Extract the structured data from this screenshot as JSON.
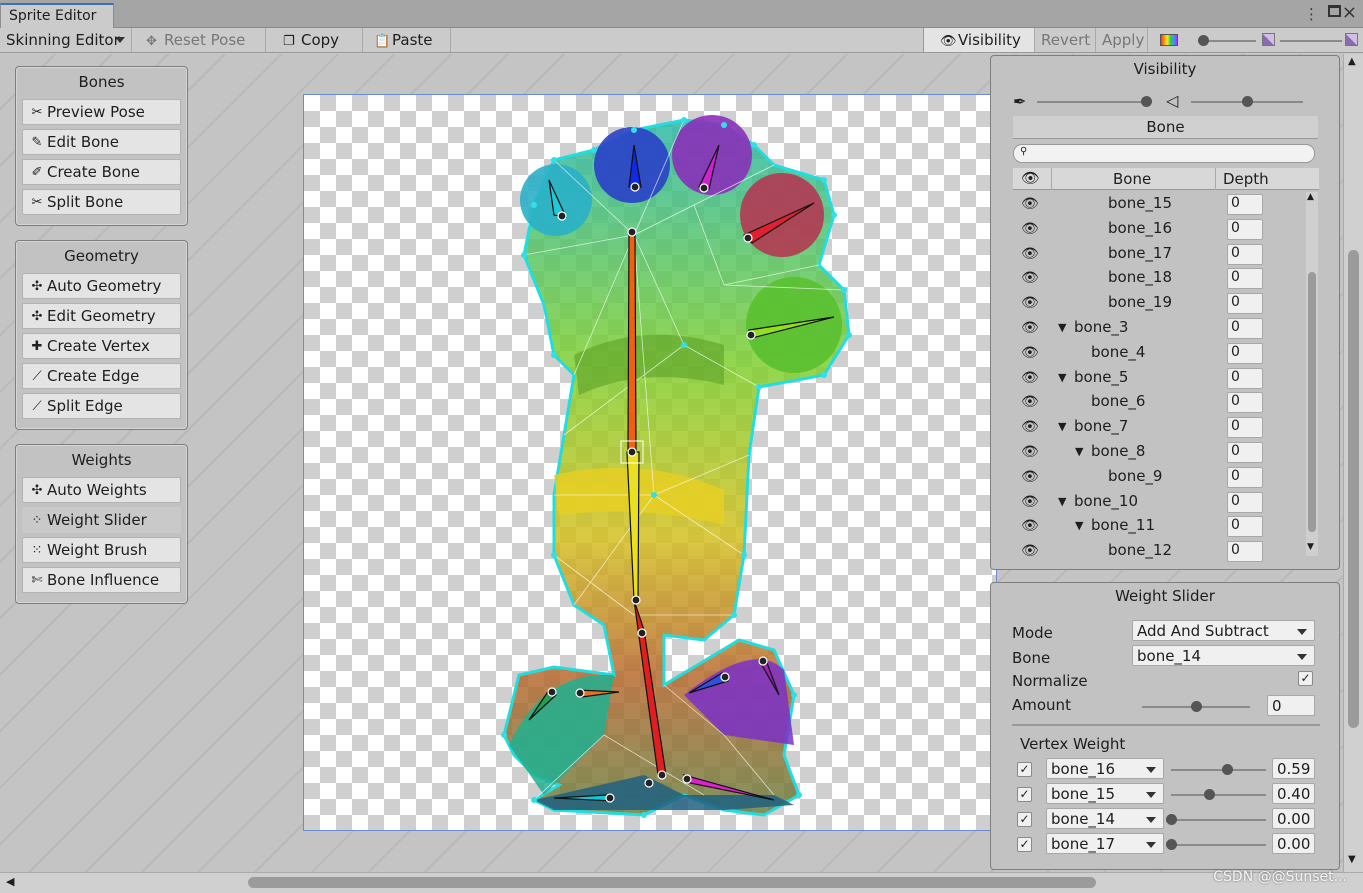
{
  "window": {
    "tab_title": "Sprite Editor"
  },
  "toolbar": {
    "mode_dropdown": "Skinning Editor",
    "reset_pose": "Reset Pose",
    "copy": "Copy",
    "paste": "Paste",
    "visibility": "Visibility",
    "revert": "Revert",
    "apply": "Apply"
  },
  "panels": {
    "bones": {
      "title": "Bones",
      "items": [
        "Preview Pose",
        "Edit Bone",
        "Create Bone",
        "Split Bone"
      ]
    },
    "geometry": {
      "title": "Geometry",
      "items": [
        "Auto Geometry",
        "Edit Geometry",
        "Create Vertex",
        "Create Edge",
        "Split Edge"
      ]
    },
    "weights": {
      "title": "Weights",
      "items": [
        "Auto Weights",
        "Weight Slider",
        "Weight Brush",
        "Bone Influence"
      ],
      "selected": "Weight Slider"
    }
  },
  "visibility_panel": {
    "title": "Visibility",
    "tab": "Bone",
    "search_placeholder": "",
    "columns": {
      "name": "Bone",
      "depth": "Depth"
    },
    "rows": [
      {
        "name": "bone_15",
        "depth": "0",
        "indent": 3,
        "expander": false
      },
      {
        "name": "bone_16",
        "depth": "0",
        "indent": 3,
        "expander": false
      },
      {
        "name": "bone_17",
        "depth": "0",
        "indent": 3,
        "expander": false
      },
      {
        "name": "bone_18",
        "depth": "0",
        "indent": 3,
        "expander": false
      },
      {
        "name": "bone_19",
        "depth": "0",
        "indent": 3,
        "expander": false
      },
      {
        "name": "bone_3",
        "depth": "0",
        "indent": 1,
        "expander": true
      },
      {
        "name": "bone_4",
        "depth": "0",
        "indent": 2,
        "expander": false
      },
      {
        "name": "bone_5",
        "depth": "0",
        "indent": 1,
        "expander": true
      },
      {
        "name": "bone_6",
        "depth": "0",
        "indent": 2,
        "expander": false
      },
      {
        "name": "bone_7",
        "depth": "0",
        "indent": 1,
        "expander": true
      },
      {
        "name": "bone_8",
        "depth": "0",
        "indent": 2,
        "expander": true
      },
      {
        "name": "bone_9",
        "depth": "0",
        "indent": 3,
        "expander": false
      },
      {
        "name": "bone_10",
        "depth": "0",
        "indent": 1,
        "expander": true
      },
      {
        "name": "bone_11",
        "depth": "0",
        "indent": 2,
        "expander": true
      },
      {
        "name": "bone_12",
        "depth": "0",
        "indent": 3,
        "expander": false
      }
    ]
  },
  "weight_slider_panel": {
    "title": "Weight Slider",
    "mode_label": "Mode",
    "mode_value": "Add And Subtract",
    "bone_label": "Bone",
    "bone_value": "bone_14",
    "normalize_label": "Normalize",
    "normalize_checked": "✓",
    "amount_label": "Amount",
    "amount_value": "0",
    "amount_fraction": 0.5,
    "vertex_weight_label": "Vertex Weight",
    "vertex_weights": [
      {
        "bone": "bone_16",
        "value": "0.59",
        "fraction": 0.59,
        "checked": "✓"
      },
      {
        "bone": "bone_15",
        "value": "0.40",
        "fraction": 0.4,
        "checked": "✓"
      },
      {
        "bone": "bone_14",
        "value": "0.00",
        "fraction": 0.0,
        "checked": "✓"
      },
      {
        "bone": "bone_17",
        "value": "0.00",
        "fraction": 0.0,
        "checked": "✓"
      }
    ]
  },
  "watermark": "CSDN @@Sunset..."
}
